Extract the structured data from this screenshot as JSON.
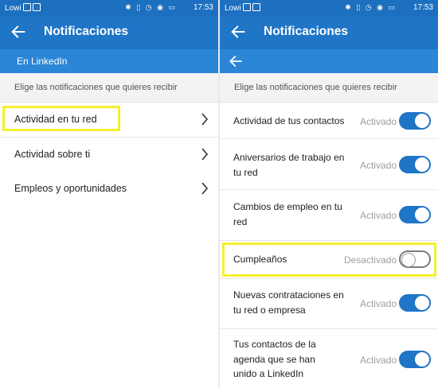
{
  "status_bar": {
    "carrier": "Lowi",
    "time": "17:53",
    "icons": [
      "bluetooth-icon",
      "vibrate-icon",
      "alarm-icon",
      "wifi-icon",
      "battery-icon"
    ]
  },
  "left": {
    "title": "Notificaciones",
    "section": "En LinkedIn",
    "hint": "Elige las notificaciones que quieres recibir",
    "items": [
      {
        "label": "Actividad en tu red",
        "highlighted": true
      },
      {
        "label": "Actividad sobre ti",
        "highlighted": false
      },
      {
        "label": "Empleos y oportunidades",
        "highlighted": false
      }
    ]
  },
  "right": {
    "title": "Notificaciones",
    "hint": "Elige las notificaciones que quieres recibir",
    "items": [
      {
        "label": "Actividad de tus contactos",
        "state": "Activado",
        "on": true
      },
      {
        "label": "Aniversarios de trabajo en tu red",
        "state": "Activado",
        "on": true
      },
      {
        "label": "Cambios de empleo en tu red",
        "state": "Activado",
        "on": true
      },
      {
        "label": "Cumpleaños",
        "state": "Desactivado",
        "on": false,
        "highlighted": true
      },
      {
        "label": "Nuevas contrataciones en tu red o empresa",
        "state": "Activado",
        "on": true
      },
      {
        "label": "Tus contactos de la agenda que se han unido a LinkedIn",
        "state": "Activado",
        "on": true
      }
    ]
  },
  "colors": {
    "toolbar": "#1f75c6",
    "subbar": "#2b86d8",
    "toggle_on": "#1f75c6",
    "highlight": "#f6ef2e"
  }
}
